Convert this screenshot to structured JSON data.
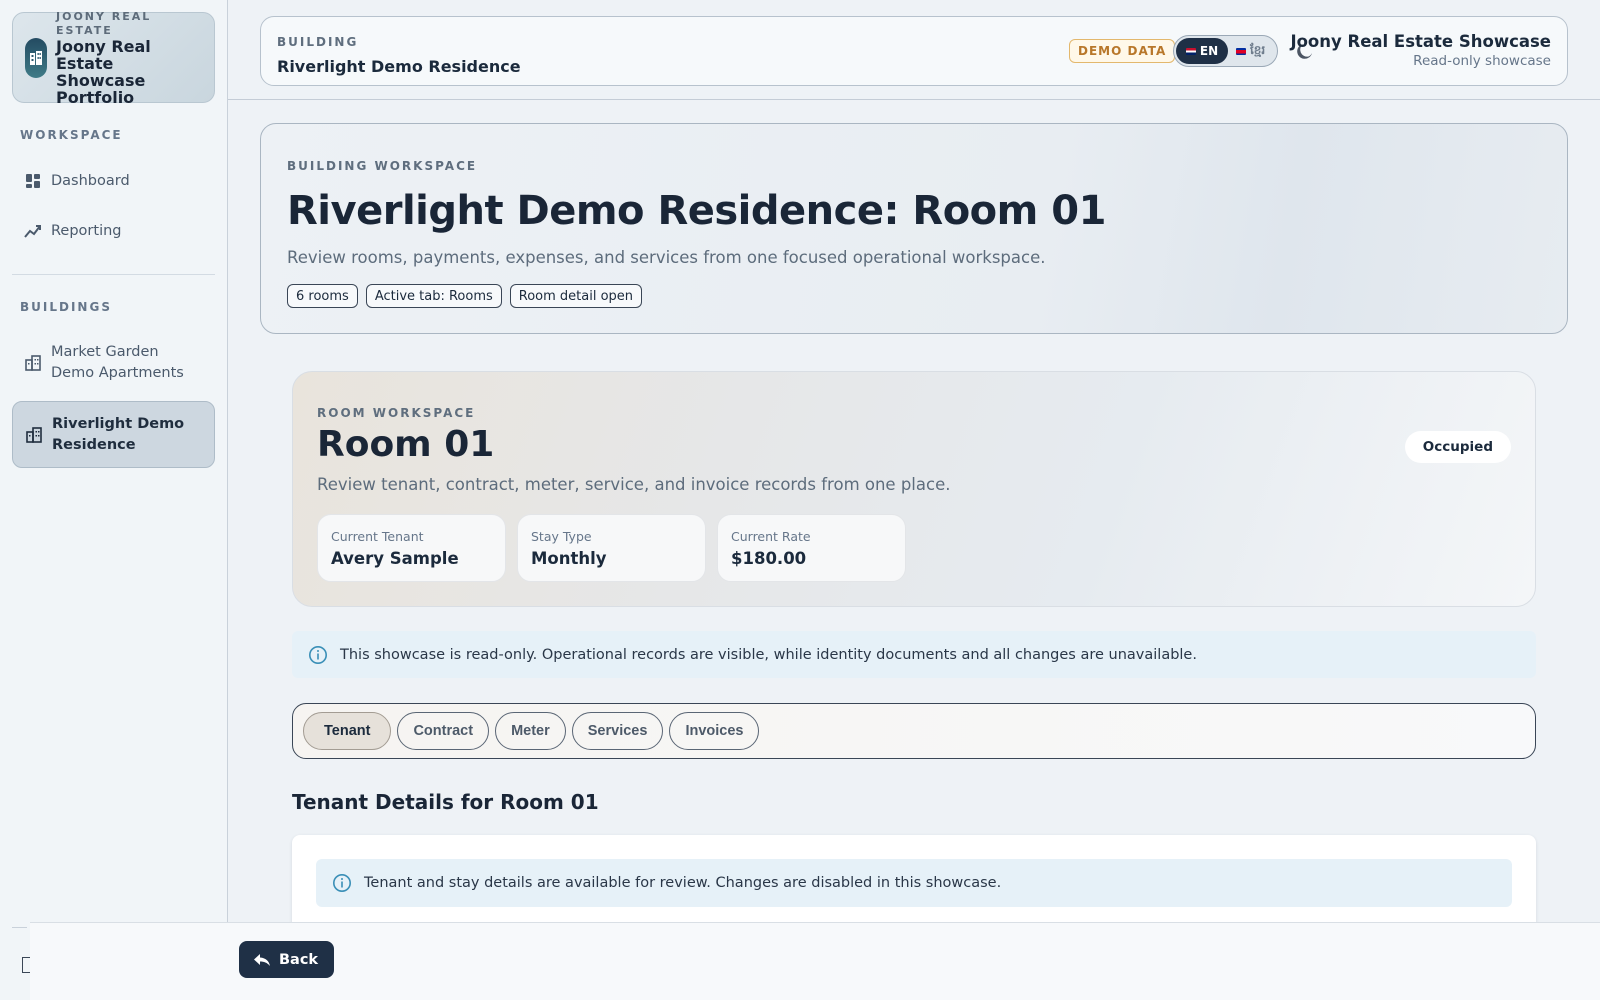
{
  "brand": {
    "eyebrow": "JOONY REAL ESTATE",
    "name": "Joony Real Estate Showcase Portfolio"
  },
  "sidebar": {
    "workspace_heading": "WORKSPACE",
    "workspace_items": [
      {
        "label": "Dashboard",
        "icon": "dashboard-icon"
      },
      {
        "label": "Reporting",
        "icon": "chart-line-icon"
      }
    ],
    "buildings_heading": "BUILDINGS",
    "buildings": [
      {
        "label": "Market Garden Demo Apartments",
        "icon": "building-icon",
        "active": false
      },
      {
        "label": "Riverlight Demo Residence",
        "icon": "building-icon",
        "active": true
      }
    ]
  },
  "header": {
    "eyebrow": "BUILDING",
    "title": "Riverlight Demo Residence",
    "demo_badge": "DEMO DATA",
    "languages": [
      {
        "code": "EN",
        "active": true
      },
      {
        "code": "ខ្មែរ",
        "active": false
      }
    ],
    "theme_icon": "moon-icon",
    "user_name": "Joony Real Estate Showcase",
    "user_role": "Read-only showcase"
  },
  "hero": {
    "eyebrow": "BUILDING WORKSPACE",
    "title": "Riverlight Demo Residence: Room 01",
    "subtitle": "Review rooms, payments, expenses, and services from one focused operational workspace.",
    "chips": [
      "6 rooms",
      "Active tab: Rooms",
      "Room detail open"
    ]
  },
  "room": {
    "eyebrow": "ROOM WORKSPACE",
    "title": "Room 01",
    "subtitle": "Review tenant, contract, meter, service, and invoice records from one place.",
    "status": "Occupied",
    "stats": [
      {
        "label": "Current Tenant",
        "value": "Avery Sample"
      },
      {
        "label": "Stay Type",
        "value": "Monthly"
      },
      {
        "label": "Current Rate",
        "value": "$180.00"
      }
    ]
  },
  "notices": {
    "readonly": "This showcase is read-only. Operational records are visible, while identity documents and all changes are unavailable.",
    "tenant": "Tenant and stay details are available for review. Changes are disabled in this showcase."
  },
  "tabs": [
    {
      "label": "Tenant",
      "active": true
    },
    {
      "label": "Contract",
      "active": false
    },
    {
      "label": "Meter",
      "active": false
    },
    {
      "label": "Services",
      "active": false
    },
    {
      "label": "Invoices",
      "active": false
    }
  ],
  "section_title": "Tenant Details for Room 01",
  "footer": {
    "back_label": "Back",
    "back_icon": "reply-arrow-icon"
  },
  "colors": {
    "accent_dark": "#1f3046",
    "demo_badge": "#b8772a",
    "notice_bg": "#e6f1f8",
    "info_icon": "#3a8fb7"
  }
}
